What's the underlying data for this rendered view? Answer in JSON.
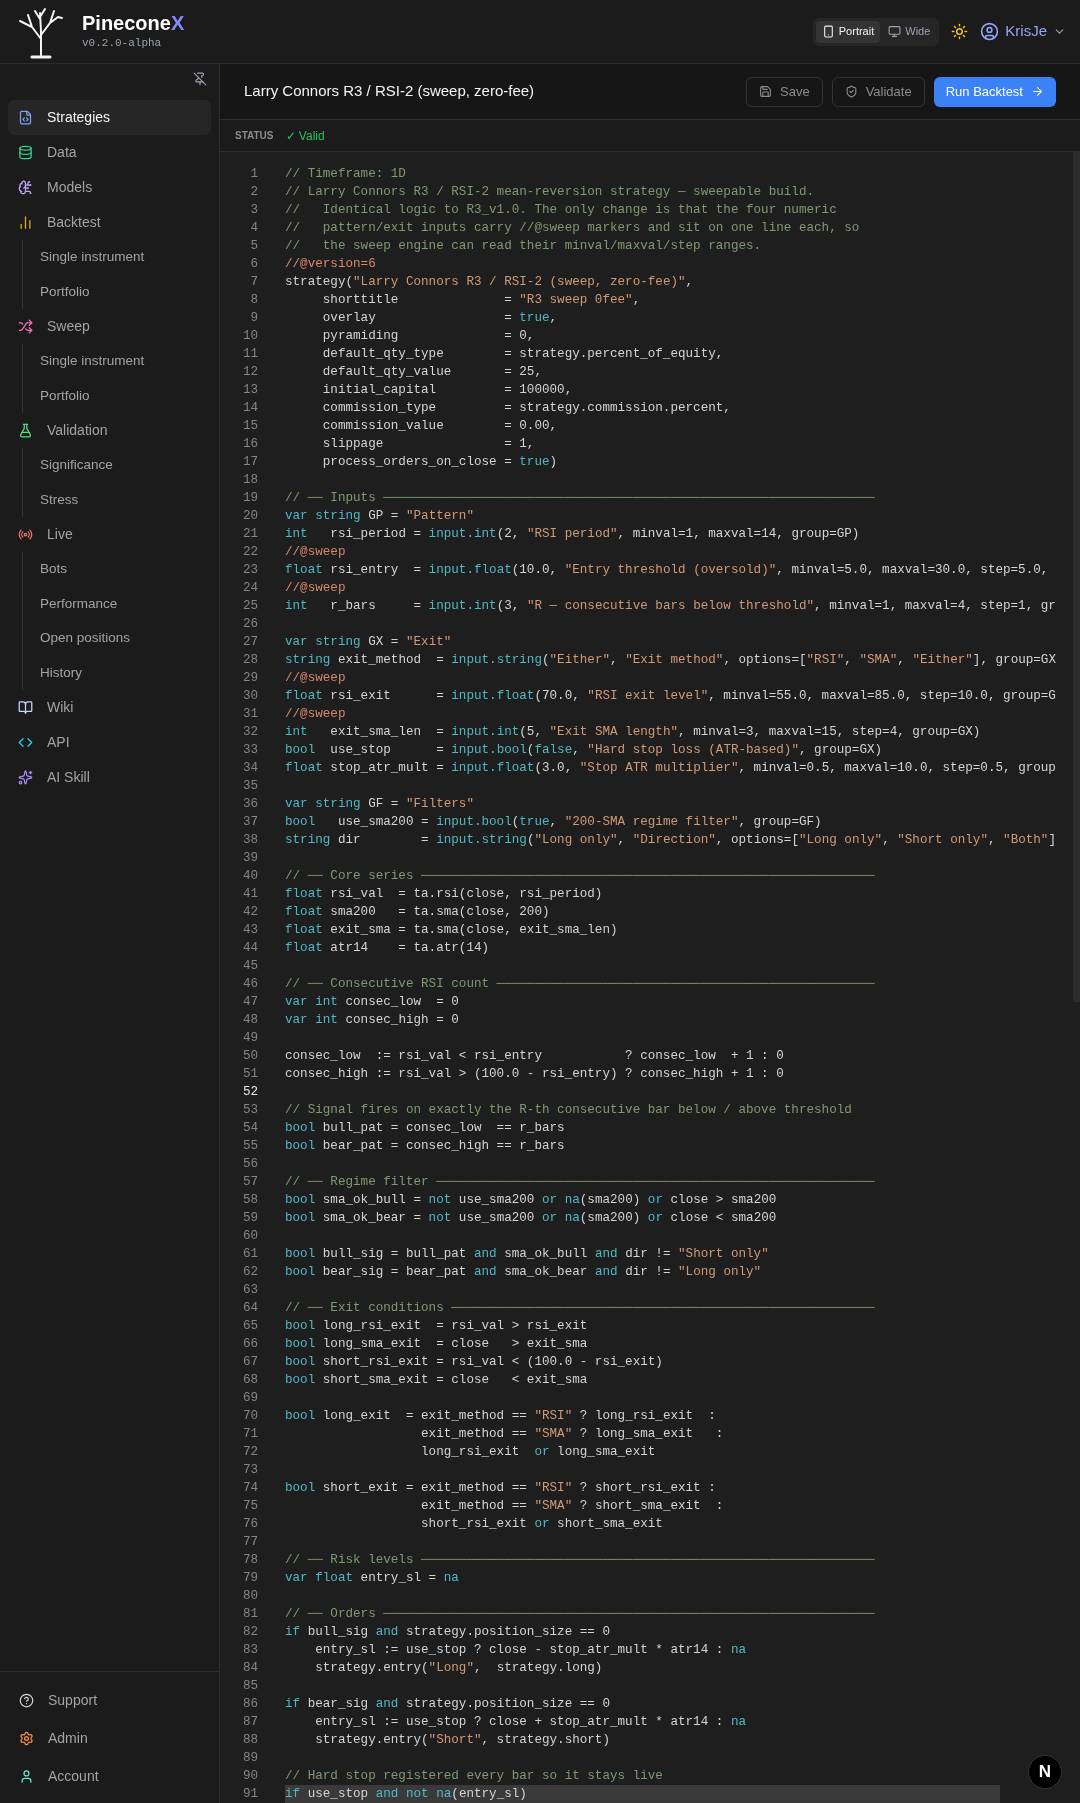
{
  "app": {
    "name": "Pinecone",
    "name_accent": "X",
    "version": "v0.2.0-alpha"
  },
  "layout_toggle": [
    {
      "label": "Portrait",
      "selected": true
    },
    {
      "label": "Wide",
      "selected": false
    }
  ],
  "user": {
    "name": "KrisJe"
  },
  "sidebar": {
    "items": [
      {
        "label": "Strategies",
        "selected": true
      },
      {
        "label": "Data",
        "selected": false
      },
      {
        "label": "Models",
        "selected": false
      },
      {
        "label": "Backtest",
        "selected": false,
        "children": [
          {
            "label": "Single instrument",
            "selected": false
          },
          {
            "label": "Portfolio",
            "selected": false
          }
        ]
      },
      {
        "label": "Sweep",
        "selected": false,
        "children": [
          {
            "label": "Single instrument",
            "selected": false
          },
          {
            "label": "Portfolio",
            "selected": false
          }
        ]
      },
      {
        "label": "Validation",
        "selected": false,
        "children": [
          {
            "label": "Significance",
            "selected": false
          },
          {
            "label": "Stress",
            "selected": false
          }
        ]
      },
      {
        "label": "Live",
        "selected": false,
        "children": [
          {
            "label": "Bots",
            "selected": false
          },
          {
            "label": "Performance",
            "selected": false
          },
          {
            "label": "Open positions",
            "selected": false
          },
          {
            "label": "History",
            "selected": false
          }
        ]
      },
      {
        "label": "Wiki",
        "selected": false
      },
      {
        "label": "API",
        "selected": false
      },
      {
        "label": "AI Skill",
        "selected": false
      }
    ],
    "footer_items": [
      {
        "label": "Support",
        "selected": false
      },
      {
        "label": "Admin",
        "selected": false
      },
      {
        "label": "Account",
        "selected": false
      }
    ]
  },
  "editor": {
    "title": "Larry Connors R3 / RSI-2 (sweep, zero-fee)",
    "buttons": [
      {
        "label": "Save",
        "kind": "save"
      },
      {
        "label": "Validate",
        "kind": "validate"
      },
      {
        "label": "Run Backtest",
        "kind": "run"
      }
    ],
    "status_label": "STATUS",
    "status_value": "✓ Valid",
    "lines": [
      {
        "n": "1",
        "code": "// Timeframe: 1D"
      },
      {
        "n": "2",
        "code": "// Larry Connors R3 / RSI-2 mean-reversion strategy — sweepable build."
      },
      {
        "n": "3",
        "code": "//   Identical logic to R3_v1.0. The only change is that the four numeric"
      },
      {
        "n": "4",
        "code": "//   pattern/exit inputs carry //@sweep markers and sit on one line each, so"
      },
      {
        "n": "5",
        "code": "//   the sweep engine can read their minval/maxval/step ranges."
      },
      {
        "n": "6",
        "code": "//@version=6"
      },
      {
        "n": "7",
        "code": "strategy(\"Larry Connors R3 / RSI-2 (sweep, zero-fee)\","
      },
      {
        "n": "8",
        "code": "     shorttitle              = \"R3 sweep 0fee\","
      },
      {
        "n": "9",
        "code": "     overlay                 = true,"
      },
      {
        "n": "10",
        "code": "     pyramiding              = 0,"
      },
      {
        "n": "11",
        "code": "     default_qty_type        = strategy.percent_of_equity,"
      },
      {
        "n": "12",
        "code": "     default_qty_value       = 25,"
      },
      {
        "n": "13",
        "code": "     initial_capital         = 100000,"
      },
      {
        "n": "14",
        "code": "     commission_type         = strategy.commission.percent,"
      },
      {
        "n": "15",
        "code": "     commission_value        = 0.00,"
      },
      {
        "n": "16",
        "code": "     slippage                = 1,"
      },
      {
        "n": "17",
        "code": "     process_orders_on_close = true)"
      },
      {
        "n": "18"
      },
      {
        "n": "19",
        "code": "// ── Inputs ─────────────────────────────────────────────────────────────────"
      },
      {
        "n": "20",
        "code": "var string GP = \"Pattern\""
      },
      {
        "n": "21",
        "code": "int   rsi_period = input.int(2, \"RSI period\", minval=1, maxval=14, group=GP)"
      },
      {
        "n": "22",
        "code": "//@sweep"
      },
      {
        "n": "23",
        "code": "float rsi_entry  = input.float(10.0, \"Entry threshold (oversold)\", minval=5.0, maxval=30.0, step=5.0,"
      },
      {
        "n": "24",
        "code": "//@sweep"
      },
      {
        "n": "25",
        "code": "int   r_bars     = input.int(3, \"R — consecutive bars below threshold\", minval=1, maxval=4, step=1, gr"
      },
      {
        "n": "26"
      },
      {
        "n": "27",
        "code": "var string GX = \"Exit\""
      },
      {
        "n": "28",
        "code": "string exit_method  = input.string(\"Either\", \"Exit method\", options=[\"RSI\", \"SMA\", \"Either\"], group=GX"
      },
      {
        "n": "29",
        "code": "//@sweep"
      },
      {
        "n": "30",
        "code": "float rsi_exit      = input.float(70.0, \"RSI exit level\", minval=55.0, maxval=85.0, step=10.0, group=G"
      },
      {
        "n": "31",
        "code": "//@sweep"
      },
      {
        "n": "32",
        "code": "int   exit_sma_len  = input.int(5, \"Exit SMA length\", minval=3, maxval=15, step=4, group=GX)"
      },
      {
        "n": "33",
        "code": "bool  use_stop      = input.bool(false, \"Hard stop loss (ATR-based)\", group=GX)"
      },
      {
        "n": "34",
        "code": "float stop_atr_mult = input.float(3.0, \"Stop ATR multiplier\", minval=0.5, maxval=10.0, step=0.5, group"
      },
      {
        "n": "35"
      },
      {
        "n": "36",
        "code": "var string GF = \"Filters\""
      },
      {
        "n": "37",
        "code": "bool   use_sma200 = input.bool(true, \"200-SMA regime filter\", group=GF)"
      },
      {
        "n": "38",
        "code": "string dir        = input.string(\"Long only\", \"Direction\", options=[\"Long only\", \"Short only\", \"Both\"]"
      },
      {
        "n": "39"
      },
      {
        "n": "40",
        "code": "// ── Core series ────────────────────────────────────────────────────────────"
      },
      {
        "n": "41",
        "code": "float rsi_val  = ta.rsi(close, rsi_period)"
      },
      {
        "n": "42",
        "code": "float sma200   = ta.sma(close, 200)"
      },
      {
        "n": "43",
        "code": "float exit_sma = ta.sma(close, exit_sma_len)"
      },
      {
        "n": "44",
        "code": "float atr14    = ta.atr(14)"
      },
      {
        "n": "45"
      },
      {
        "n": "46",
        "code": "// ── Consecutive RSI count ──────────────────────────────────────────────────"
      },
      {
        "n": "47",
        "code": "var int consec_low  = 0"
      },
      {
        "n": "48",
        "code": "var int consec_high = 0"
      },
      {
        "n": "49"
      },
      {
        "n": "50",
        "code": "consec_low  := rsi_val < rsi_entry           ? consec_low  + 1 : 0"
      },
      {
        "n": "51",
        "code": "consec_high := rsi_val > (100.0 - rsi_entry) ? consec_high + 1 : 0"
      },
      {
        "n": "52",
        "active": true
      },
      {
        "n": "53",
        "code": "// Signal fires on exactly the R-th consecutive bar below / above threshold"
      },
      {
        "n": "54",
        "code": "bool bull_pat = consec_low  == r_bars"
      },
      {
        "n": "55",
        "code": "bool bear_pat = consec_high == r_bars"
      },
      {
        "n": "56"
      },
      {
        "n": "57",
        "code": "// ── Regime filter ──────────────────────────────────────────────────────────"
      },
      {
        "n": "58",
        "code": "bool sma_ok_bull = not use_sma200 or na(sma200) or close > sma200"
      },
      {
        "n": "59",
        "code": "bool sma_ok_bear = not use_sma200 or na(sma200) or close < sma200"
      },
      {
        "n": "60"
      },
      {
        "n": "61",
        "code": "bool bull_sig = bull_pat and sma_ok_bull and dir != \"Short only\""
      },
      {
        "n": "62",
        "code": "bool bear_sig = bear_pat and sma_ok_bear and dir != \"Long only\""
      },
      {
        "n": "63"
      },
      {
        "n": "64",
        "code": "// ── Exit conditions ────────────────────────────────────────────────────────"
      },
      {
        "n": "65",
        "code": "bool long_rsi_exit  = rsi_val > rsi_exit"
      },
      {
        "n": "66",
        "code": "bool long_sma_exit  = close   > exit_sma"
      },
      {
        "n": "67",
        "code": "bool short_rsi_exit = rsi_val < (100.0 - rsi_exit)"
      },
      {
        "n": "68",
        "code": "bool short_sma_exit = close   < exit_sma"
      },
      {
        "n": "69"
      },
      {
        "n": "70",
        "code": "bool long_exit  = exit_method == \"RSI\" ? long_rsi_exit  :"
      },
      {
        "n": "71",
        "code": "                  exit_method == \"SMA\" ? long_sma_exit   :"
      },
      {
        "n": "72",
        "code": "                  long_rsi_exit  or long_sma_exit"
      },
      {
        "n": "73"
      },
      {
        "n": "74",
        "code": "bool short_exit = exit_method == \"RSI\" ? short_rsi_exit :"
      },
      {
        "n": "75",
        "code": "                  exit_method == \"SMA\" ? short_sma_exit  :"
      },
      {
        "n": "76",
        "code": "                  short_rsi_exit or short_sma_exit"
      },
      {
        "n": "77"
      },
      {
        "n": "78",
        "code": "// ── Risk levels ────────────────────────────────────────────────────────────"
      },
      {
        "n": "79",
        "code": "var float entry_sl = na"
      },
      {
        "n": "80"
      },
      {
        "n": "81",
        "code": "// ── Orders ─────────────────────────────────────────────────────────────────"
      },
      {
        "n": "82",
        "code": "if bull_sig and strategy.position_size == 0"
      },
      {
        "n": "83",
        "code": "    entry_sl := use_stop ? close - stop_atr_mult * atr14 : na"
      },
      {
        "n": "84",
        "code": "    strategy.entry(\"Long\",  strategy.long)"
      },
      {
        "n": "85"
      },
      {
        "n": "86",
        "code": "if bear_sig and strategy.position_size == 0"
      },
      {
        "n": "87",
        "code": "    entry_sl := use_stop ? close + stop_atr_mult * atr14 : na"
      },
      {
        "n": "88",
        "code": "    strategy.entry(\"Short\", strategy.short)"
      },
      {
        "n": "89"
      },
      {
        "n": "90",
        "code": "// Hard stop registered every bar so it stays live"
      },
      {
        "n": "91",
        "code": "if use_stop and not na(entry_sl)",
        "selected": true
      }
    ]
  },
  "dev_badge": "N"
}
